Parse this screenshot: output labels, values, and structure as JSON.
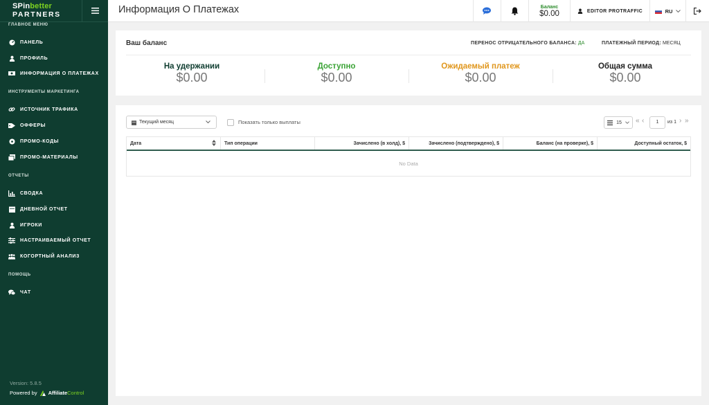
{
  "brand": {
    "logo_line1_a": "SPin",
    "logo_line1_b": "better",
    "logo_line2": "PARTNERS"
  },
  "sidebar": {
    "sections": [
      {
        "title": "Главное меню",
        "items": [
          {
            "label": "Панель",
            "icon": "dashboard-icon"
          },
          {
            "label": "Профиль",
            "icon": "user-icon"
          },
          {
            "label": "Информация о платежах",
            "icon": "money-icon"
          }
        ]
      },
      {
        "title": "Инструменты маркетинга",
        "items": [
          {
            "label": "Источник трафика",
            "icon": "link-icon"
          },
          {
            "label": "Офферы",
            "icon": "tag-icon"
          },
          {
            "label": "Промо-коды",
            "icon": "promo-icon"
          },
          {
            "label": "Промо-материалы",
            "icon": "image-icon"
          }
        ]
      },
      {
        "title": "Отчеты",
        "items": [
          {
            "label": "Сводка",
            "icon": "chart-icon"
          },
          {
            "label": "Дневной отчет",
            "icon": "calendar-icon"
          },
          {
            "label": "Игроки",
            "icon": "user-icon"
          },
          {
            "label": "Настраиваемый отчет",
            "icon": "sliders-icon"
          },
          {
            "label": "Когортный анализ",
            "icon": "users-icon"
          }
        ]
      },
      {
        "title": "Помощь",
        "items": [
          {
            "label": "Чат",
            "icon": "chat-icon"
          }
        ]
      }
    ],
    "version": "Version: 5.8.5",
    "powered_by": "Powered by",
    "powered_brand_a": "Affiliate",
    "powered_brand_b": "Control"
  },
  "header": {
    "title": "Информация О Платежах",
    "balance_label": "Баланс",
    "balance_value": "$0.00",
    "user": "EDITOR PROTRAFFIC",
    "language": "RU"
  },
  "balance_card": {
    "title": "Ваш баланс",
    "negative_carry_label": "ПЕРЕНОС ОТРИЦАТЕЛЬНОГО БАЛАНСА:",
    "negative_carry_value": "ДА",
    "period_label": "ПЛАТЕЖНЫЙ ПЕРИОД:",
    "period_value": "МЕСЯЦ",
    "stats": [
      {
        "label": "На удержании",
        "value": "$0.00",
        "color": "#0f3d30"
      },
      {
        "label": "Доступно",
        "value": "$0.00",
        "color": "#3aa335"
      },
      {
        "label": "Ожидаемый платеж",
        "value": "$0.00",
        "color": "#e0961c"
      },
      {
        "label": "Общая сумма",
        "value": "$0.00",
        "color": "#222222"
      }
    ]
  },
  "table_card": {
    "period_select": "Текущий месяц",
    "only_payouts_label": "Показать только выплаты",
    "per_page": "15",
    "page": "1",
    "of_pages": "из 1",
    "columns": [
      "Дата",
      "Тип операции",
      "Зачислено (в холд), $",
      "Зачислено (подтверждено), $",
      "Баланс (на проверке), $",
      "Доступный остаток, $"
    ],
    "empty_text": "No Data"
  }
}
